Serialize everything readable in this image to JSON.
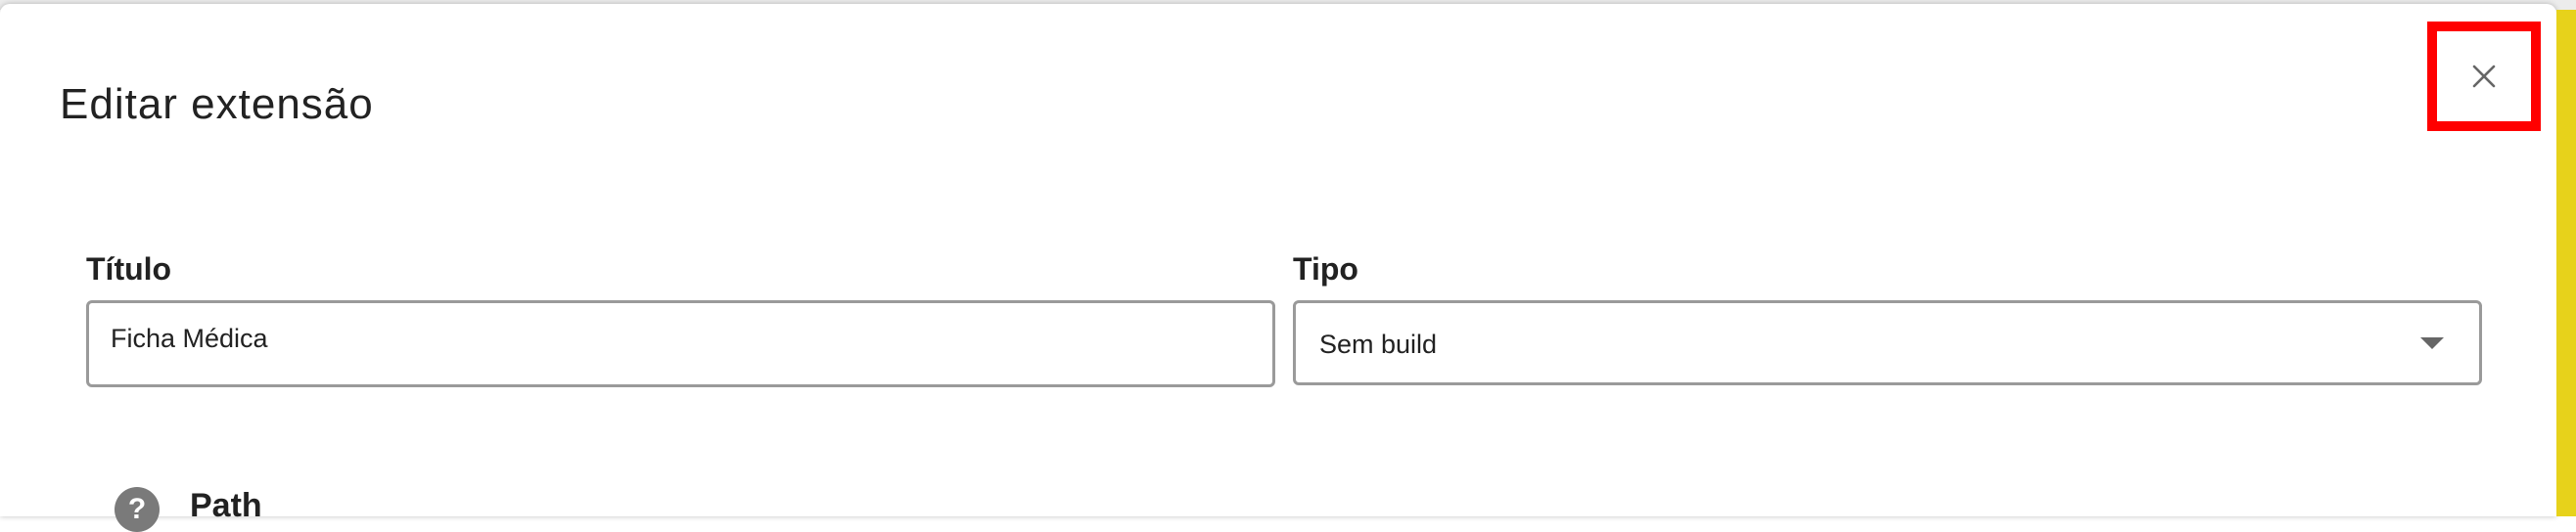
{
  "dialog": {
    "title": "Editar extensão",
    "close_icon": "close-icon"
  },
  "form": {
    "title_label": "Título",
    "title_value": "Ficha Médica",
    "type_label": "Tipo",
    "type_value": "Sem build",
    "type_caret_icon": "chevron-down-icon",
    "path_help_icon": "help-icon",
    "path_help_glyph": "?",
    "path_label": "Path"
  },
  "colors": {
    "highlight_border": "#ff0000",
    "side_strip": "#e7d21b",
    "input_border": "#9a9a9a",
    "help_icon_bg": "#7a7a7a"
  }
}
